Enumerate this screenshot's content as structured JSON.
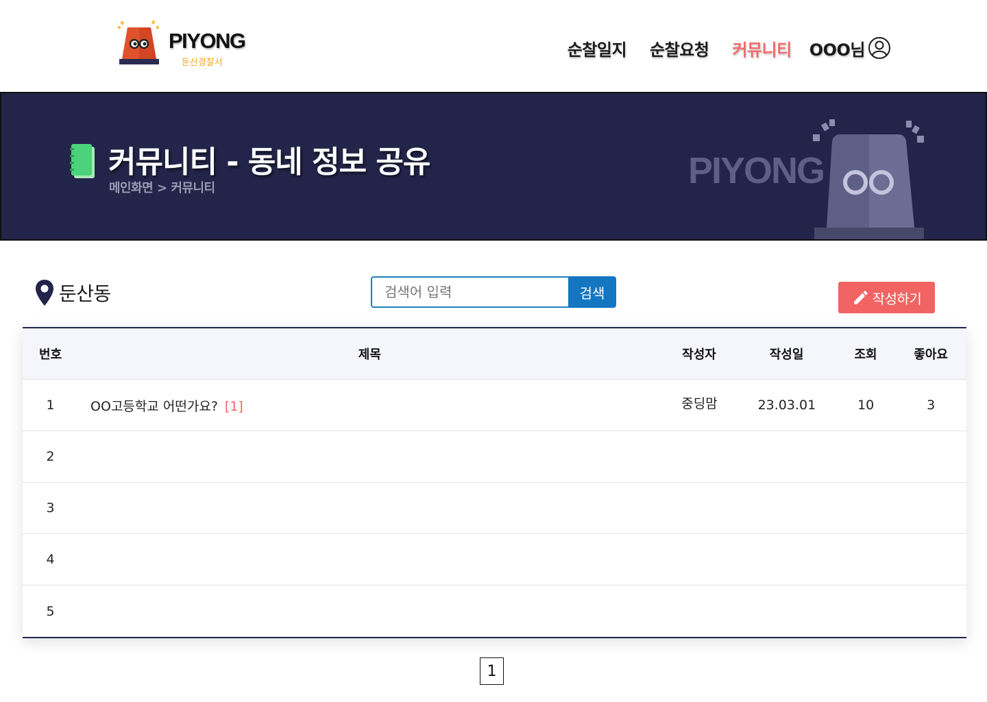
{
  "header": {
    "logo_text": "PIYONG",
    "logo_sub": "둔산경찰서",
    "nav": [
      {
        "label": "순찰일지",
        "active": false
      },
      {
        "label": "순찰요청",
        "active": false
      },
      {
        "label": "커뮤니티",
        "active": true
      }
    ],
    "user_label": "OOO님",
    "active_color": "#f26a6a"
  },
  "banner": {
    "title": "커뮤니티 - 동네 정보 공유",
    "breadcrumb": "메인화면 > 커뮤니티",
    "brand": "PIYONG",
    "background": "#222449"
  },
  "toolbar": {
    "location": "둔산동",
    "search_placeholder": "검색어 입력",
    "search_button": "검색",
    "write_button": "작성하기"
  },
  "table": {
    "columns": [
      "번호",
      "제목",
      "작성자",
      "작성일",
      "조회",
      "좋아요"
    ],
    "rows": [
      {
        "num": "1",
        "title": "OO고등학교 어떤가요?",
        "comments": "[1]",
        "author": "중딩맘",
        "date": "23.03.01",
        "views": "10",
        "likes": "3"
      },
      {
        "num": "2",
        "title": "",
        "comments": "",
        "author": "",
        "date": "",
        "views": "",
        "likes": ""
      },
      {
        "num": "3",
        "title": "",
        "comments": "",
        "author": "",
        "date": "",
        "views": "",
        "likes": ""
      },
      {
        "num": "4",
        "title": "",
        "comments": "",
        "author": "",
        "date": "",
        "views": "",
        "likes": ""
      },
      {
        "num": "5",
        "title": "",
        "comments": "",
        "author": "",
        "date": "",
        "views": "",
        "likes": ""
      }
    ]
  },
  "pagination": {
    "current_page": "1"
  },
  "icons": {
    "logo": "siren-mascot-icon",
    "user": "user-circle-icon",
    "book": "notebook-icon",
    "pin": "location-pin-icon",
    "pencil": "pencil-icon"
  }
}
